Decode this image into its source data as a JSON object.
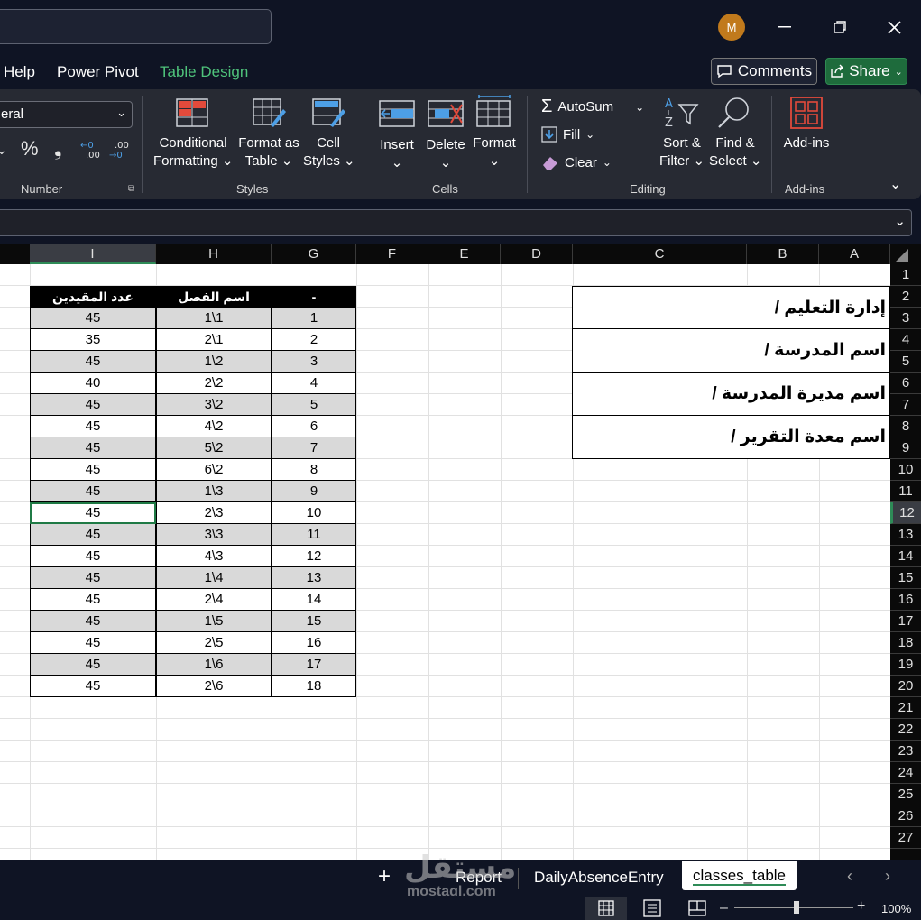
{
  "user": {
    "avatar_initial": "M"
  },
  "menu": {
    "tabs": [
      "Help",
      "Power Pivot",
      "Table Design"
    ],
    "comments_label": "Comments",
    "share_label": "Share"
  },
  "ribbon": {
    "font_value": "eral",
    "number_group": "Number",
    "styles_group": "Styles",
    "cells_group": "Cells",
    "editing_group": "Editing",
    "addins_group": "Add-ins",
    "conditional_formatting": [
      "Conditional",
      "Formatting"
    ],
    "format_as_table": [
      "Format as",
      "Table"
    ],
    "cell_styles": [
      "Cell",
      "Styles"
    ],
    "insert": "Insert",
    "delete": "Delete",
    "format": "Format",
    "autosum": "AutoSum",
    "fill": "Fill",
    "clear": "Clear",
    "sort_filter": [
      "Sort &",
      "Filter"
    ],
    "find_select": [
      "Find &",
      "Select"
    ],
    "addins": "Add-ins",
    "number_symbols": [
      "%",
      "❟"
    ]
  },
  "sheet": {
    "col_headers": [
      "I",
      "H",
      "G",
      "F",
      "E",
      "D",
      "C",
      "B",
      "A"
    ],
    "row_numbers": [
      "1",
      "2",
      "3",
      "4",
      "5",
      "6",
      "7",
      "8",
      "9",
      "10",
      "11",
      "12",
      "13",
      "14",
      "15",
      "16",
      "17",
      "18",
      "19",
      "20",
      "21",
      "22",
      "23",
      "24",
      "25",
      "26",
      "27"
    ],
    "selected_row": "12",
    "selected_col": "I",
    "table_headers": {
      "count": "عدد المقيدين",
      "class": "اسم الفصل",
      "index": "-"
    },
    "rows": [
      {
        "count": "45",
        "cls": "1\\1",
        "idx": "1"
      },
      {
        "count": "35",
        "cls": "2\\1",
        "idx": "2"
      },
      {
        "count": "45",
        "cls": "1\\2",
        "idx": "3"
      },
      {
        "count": "40",
        "cls": "2\\2",
        "idx": "4"
      },
      {
        "count": "45",
        "cls": "3\\2",
        "idx": "5"
      },
      {
        "count": "45",
        "cls": "4\\2",
        "idx": "6"
      },
      {
        "count": "45",
        "cls": "5\\2",
        "idx": "7"
      },
      {
        "count": "45",
        "cls": "6\\2",
        "idx": "8"
      },
      {
        "count": "45",
        "cls": "1\\3",
        "idx": "9"
      },
      {
        "count": "45",
        "cls": "2\\3",
        "idx": "10"
      },
      {
        "count": "45",
        "cls": "3\\3",
        "idx": "11"
      },
      {
        "count": "45",
        "cls": "4\\3",
        "idx": "12"
      },
      {
        "count": "45",
        "cls": "1\\4",
        "idx": "13"
      },
      {
        "count": "45",
        "cls": "2\\4",
        "idx": "14"
      },
      {
        "count": "45",
        "cls": "1\\5",
        "idx": "15"
      },
      {
        "count": "45",
        "cls": "2\\5",
        "idx": "16"
      },
      {
        "count": "45",
        "cls": "1\\6",
        "idx": "17"
      },
      {
        "count": "45",
        "cls": "2\\6",
        "idx": "18"
      }
    ],
    "info_boxes": [
      "إدارة التعليم /",
      "اسم المدرسة /",
      "اسم مديرة المدرسة /",
      "اسم معدة التقرير /"
    ]
  },
  "sheet_tabs": {
    "report": "Report",
    "daily": "DailyAbsenceEntry",
    "classes": "classes_table"
  },
  "status": {
    "zoom": "100%"
  },
  "watermark": {
    "main": "مستقل",
    "sub": "mostaql.com"
  },
  "colors": {
    "accent_green": "#4fc37b",
    "share_bg": "#1e6b3c",
    "header_black": "#000000",
    "alt_row": "#d9d9d9"
  }
}
